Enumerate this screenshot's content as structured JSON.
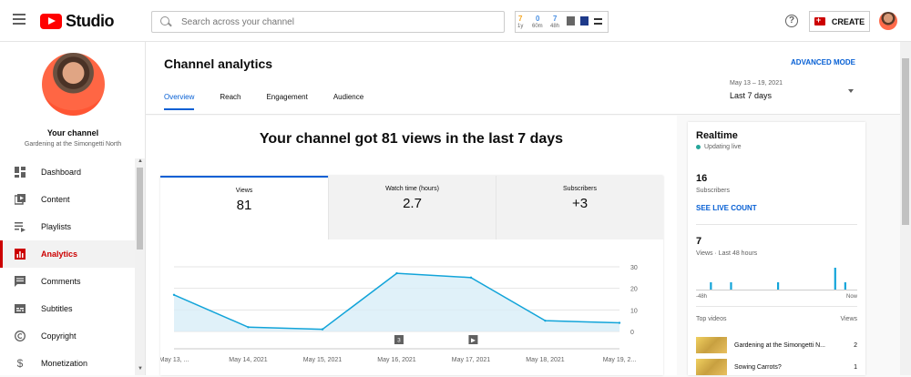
{
  "app": {
    "name": "Studio"
  },
  "search": {
    "placeholder": "Search across your channel"
  },
  "extension": {
    "stats": [
      {
        "value": "7",
        "label": "1y",
        "color": "#f5a623"
      },
      {
        "value": "0",
        "label": "60m",
        "color": "#4a90e2"
      },
      {
        "value": "7",
        "label": "48h",
        "color": "#4a90e2"
      }
    ]
  },
  "topbar": {
    "create_label": "CREATE"
  },
  "sidebar": {
    "title": "Your channel",
    "channel_name": "Gardening at the Simongetti North",
    "items": [
      {
        "label": "Dashboard",
        "icon": "dashboard-icon"
      },
      {
        "label": "Content",
        "icon": "content-icon"
      },
      {
        "label": "Playlists",
        "icon": "playlists-icon"
      },
      {
        "label": "Analytics",
        "icon": "analytics-icon",
        "active": true
      },
      {
        "label": "Comments",
        "icon": "comments-icon"
      },
      {
        "label": "Subtitles",
        "icon": "subtitles-icon"
      },
      {
        "label": "Copyright",
        "icon": "copyright-icon"
      },
      {
        "label": "Monetization",
        "icon": "monetization-icon"
      }
    ]
  },
  "header": {
    "title": "Channel analytics",
    "advanced_mode": "ADVANCED MODE",
    "tabs": [
      "Overview",
      "Reach",
      "Engagement",
      "Audience"
    ],
    "date_range": "May 13 – 19, 2021",
    "date_label": "Last 7 days"
  },
  "main": {
    "headline": "Your channel got 81 views in the last 7 days",
    "metrics": [
      {
        "label": "Views",
        "value": "81"
      },
      {
        "label": "Watch time (hours)",
        "value": "2.7"
      },
      {
        "label": "Subscribers",
        "value": "+3"
      }
    ]
  },
  "chart_data": {
    "type": "area",
    "x": [
      "May 13, ...",
      "May 14, 2021",
      "May 15, 2021",
      "May 16, 2021",
      "May 17, 2021",
      "May 18, 2021",
      "May 19, 2..."
    ],
    "series": [
      {
        "values": [
          17,
          2,
          1,
          27,
          25,
          5,
          4
        ]
      }
    ],
    "y_ticks": [
      0,
      10,
      20,
      30
    ],
    "ylim": [
      0,
      30
    ],
    "markers": [
      {
        "label": "3"
      },
      {
        "label": "▶"
      }
    ],
    "color": "#12a4d9"
  },
  "realtime": {
    "title": "Realtime",
    "status": "Updating live",
    "subscribers": "16",
    "subscribers_label": "Subscribers",
    "live_count_link": "SEE LIVE COUNT",
    "views": "7",
    "views_label": "Views · Last 48 hours",
    "axis_left": "-48h",
    "axis_right": "Now",
    "bars": [
      0,
      0,
      0,
      0,
      1,
      0,
      0,
      0,
      0,
      0,
      1,
      0,
      0,
      0,
      0,
      0,
      0,
      0,
      0,
      0,
      0,
      0,
      0,
      0,
      1,
      0,
      0,
      0,
      0,
      0,
      0,
      0,
      0,
      0,
      0,
      0,
      0,
      0,
      0,
      0,
      0,
      3,
      0,
      0,
      1,
      0,
      0,
      0
    ],
    "top_videos_label": "Top videos",
    "top_videos_col": "Views",
    "videos": [
      {
        "title": "Gardening at the Simongetti N...",
        "views": "2"
      },
      {
        "title": "Sowing Carrots?",
        "views": "1"
      }
    ]
  }
}
